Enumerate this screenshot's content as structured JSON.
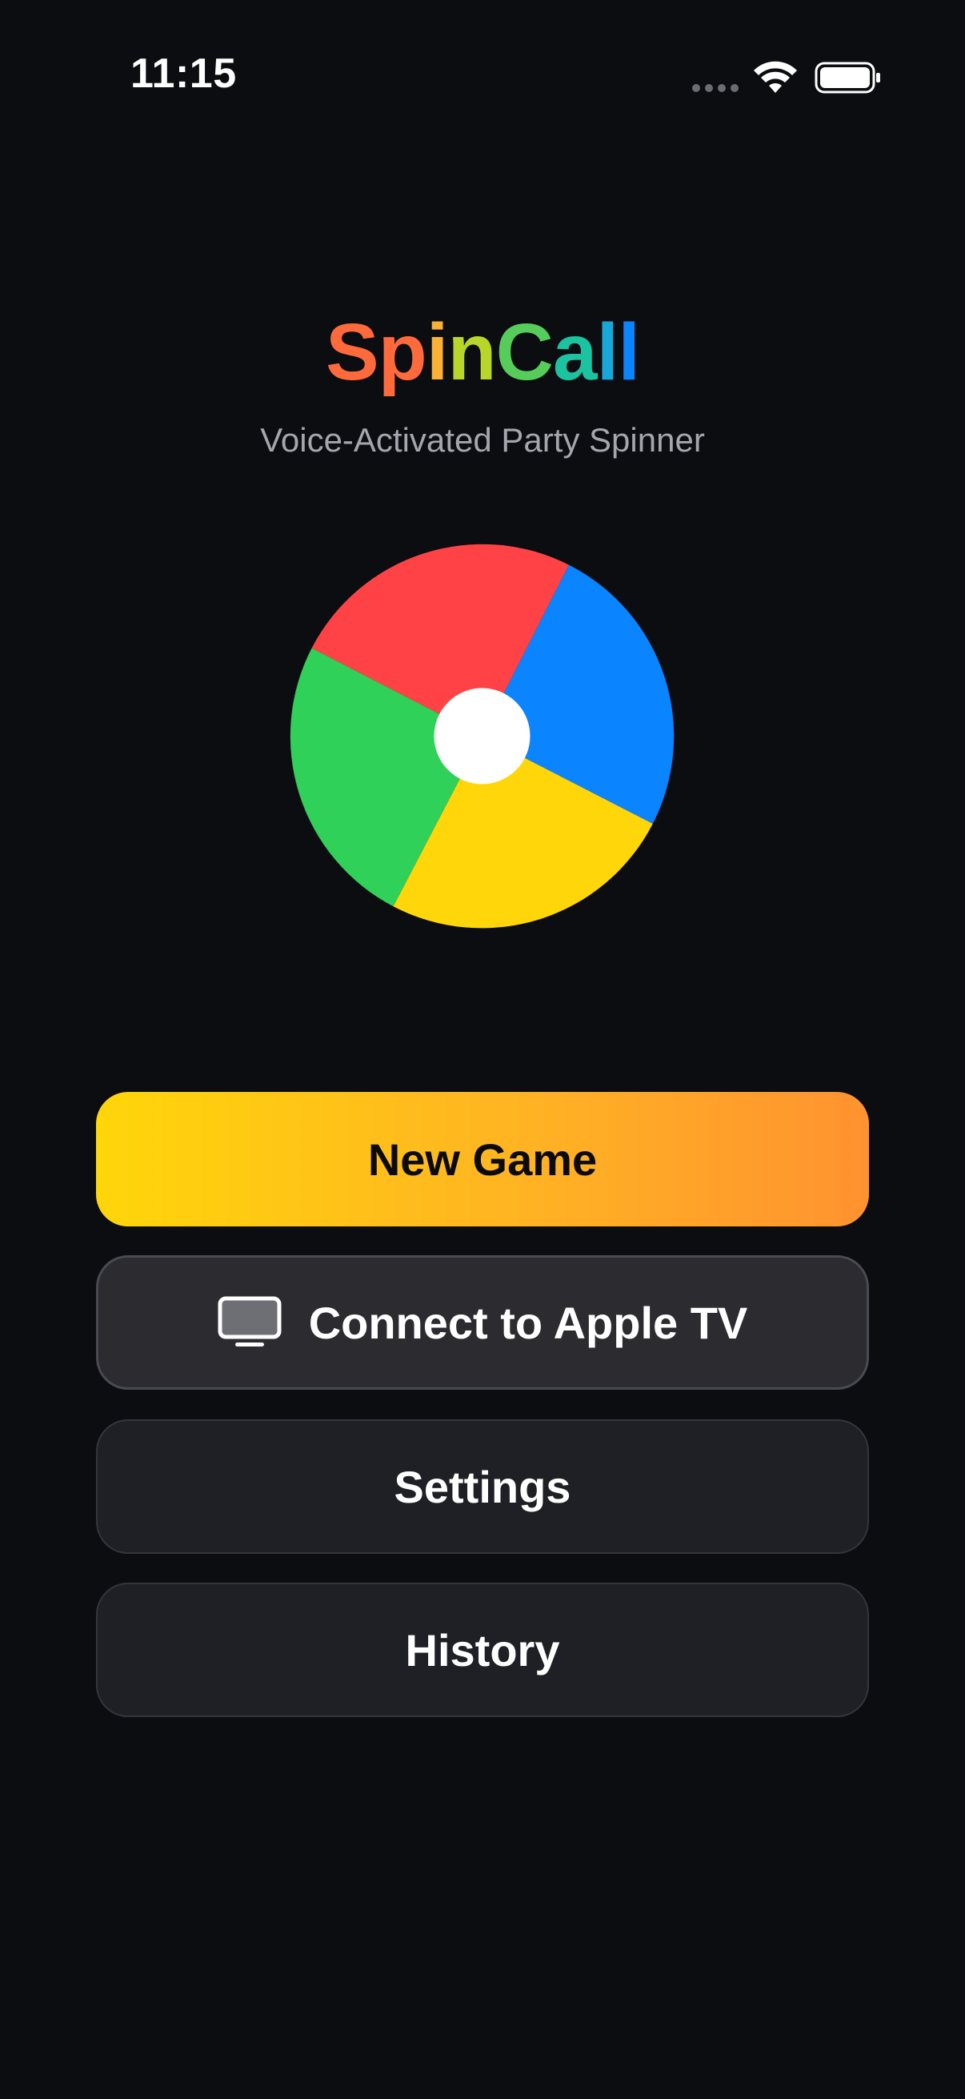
{
  "status_bar": {
    "time": "11:15",
    "signal_icon": "cellular-dots-icon",
    "wifi_icon": "wifi-icon",
    "battery_icon": "battery-icon"
  },
  "header": {
    "title_parts": [
      "Sp",
      "i",
      "n",
      "C",
      "a",
      "l",
      "l"
    ],
    "title": "SpinCall",
    "subtitle": "Voice-Activated Party Spinner"
  },
  "wheel": {
    "segments": [
      {
        "name": "red",
        "color": "#ff4245"
      },
      {
        "name": "blue",
        "color": "#0a84ff"
      },
      {
        "name": "yellow",
        "color": "#ffd60a"
      },
      {
        "name": "green",
        "color": "#30d158"
      }
    ],
    "hub_color": "#ffffff"
  },
  "buttons": {
    "new_game": "New Game",
    "connect_tv": "Connect to Apple TV",
    "connect_tv_icon": "tv-icon",
    "settings": "Settings",
    "history": "History"
  },
  "colors": {
    "background": "#0c0d11",
    "primary_gradient_start": "#ffd60a",
    "primary_gradient_end": "#ff9230",
    "secondary_button": "#2b2b30",
    "tertiary_button": "#1f2025",
    "subtitle_text": "#a4a6ad"
  }
}
